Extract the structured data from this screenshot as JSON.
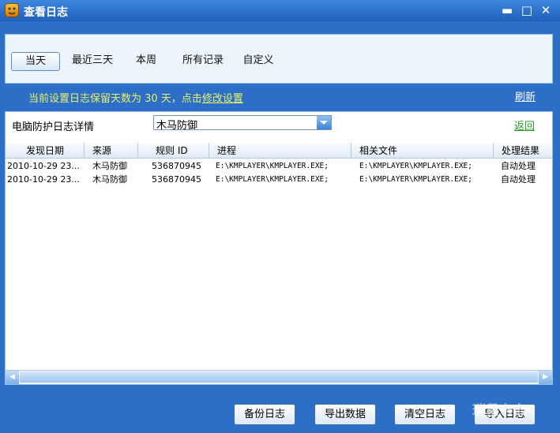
{
  "window": {
    "title": "查看日志"
  },
  "tabs": [
    {
      "label": "当天",
      "active": true
    },
    {
      "label": "最近三天",
      "active": false
    },
    {
      "label": "本周",
      "active": false
    },
    {
      "label": "所有记录",
      "active": false
    },
    {
      "label": "自定义",
      "active": false
    }
  ],
  "notice": {
    "text": "当前设置日志保留天数为 30 天，点击",
    "link": "修改设置"
  },
  "refresh_label": "刷新",
  "detail": {
    "label": "电脑防护日志详情",
    "select_value": "木马防御",
    "back_label": "返回"
  },
  "table": {
    "columns": [
      "发现日期",
      "来源",
      "规则 ID",
      "进程",
      "相关文件",
      "处理结果"
    ],
    "rows": [
      [
        "2010-10-29 23...",
        "木马防御",
        "536870945",
        "E:\\KMPLAYER\\KMPLAYER.EXE;",
        "E:\\KMPLAYER\\KMPLAYER.EXE;",
        "自动处理"
      ],
      [
        "2010-10-29 23...",
        "木马防御",
        "536870945",
        "E:\\KMPLAYER\\KMPLAYER.EXE;",
        "E:\\KMPLAYER\\KMPLAYER.EXE;",
        "自动处理"
      ]
    ]
  },
  "buttons": {
    "backup": "备份日志",
    "export": "导出数据",
    "clear": "清空日志",
    "import": "导入日志"
  },
  "watermark": "瑞星卡卡",
  "colors": {
    "accent": "#2d6fc6",
    "notice": "#e8f26a",
    "back_link": "#2a9b2a"
  }
}
